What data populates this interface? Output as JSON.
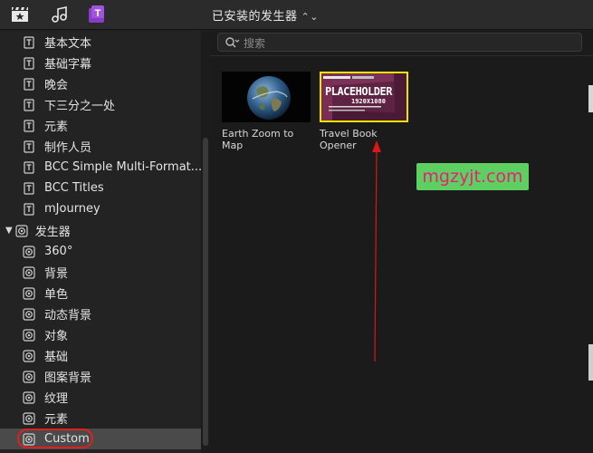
{
  "toolbar": {
    "title": "已安装的发生器",
    "icons": [
      "clapper-star-icon",
      "music-note-icon",
      "titles-t-icon"
    ]
  },
  "sidebar": {
    "items": [
      {
        "label": "基本文本",
        "icon": "title-icon"
      },
      {
        "label": "基础字幕",
        "icon": "title-icon"
      },
      {
        "label": "晚会",
        "icon": "title-icon"
      },
      {
        "label": "下三分之一处",
        "icon": "title-icon"
      },
      {
        "label": "元素",
        "icon": "title-icon"
      },
      {
        "label": "制作人员",
        "icon": "title-icon"
      },
      {
        "label": "BCC Simple Multi-Format...",
        "icon": "title-icon"
      },
      {
        "label": "BCC Titles",
        "icon": "title-icon"
      },
      {
        "label": "mJourney",
        "icon": "title-icon"
      }
    ],
    "group": {
      "label": "发生器",
      "icon": "generator-icon",
      "expanded": true
    },
    "group_items": [
      {
        "label": "360°",
        "icon": "generator-icon"
      },
      {
        "label": "背景",
        "icon": "generator-icon"
      },
      {
        "label": "单色",
        "icon": "generator-icon"
      },
      {
        "label": "动态背景",
        "icon": "generator-icon"
      },
      {
        "label": "对象",
        "icon": "generator-icon"
      },
      {
        "label": "基础",
        "icon": "generator-icon"
      },
      {
        "label": "图案背景",
        "icon": "generator-icon"
      },
      {
        "label": "纹理",
        "icon": "generator-icon"
      },
      {
        "label": "元素",
        "icon": "generator-icon"
      },
      {
        "label": "Custom",
        "icon": "generator-icon",
        "selected": true
      }
    ]
  },
  "search": {
    "placeholder": "搜索"
  },
  "browser": {
    "items": [
      {
        "label_line1": "Earth Zoom to",
        "label_line2": "Map"
      },
      {
        "label_line1": "Travel Book",
        "label_line2": "Opener",
        "thumb_text": "PLACEHOLDER",
        "thumb_sub": "1920X1080",
        "selected": true
      }
    ]
  },
  "watermark": {
    "text": "mgzyjt.com"
  },
  "colors": {
    "accent_selection": "#f2e200",
    "annotation_red": "#e0201c",
    "watermark_bg": "#5ed061",
    "watermark_text": "#e7207a"
  }
}
